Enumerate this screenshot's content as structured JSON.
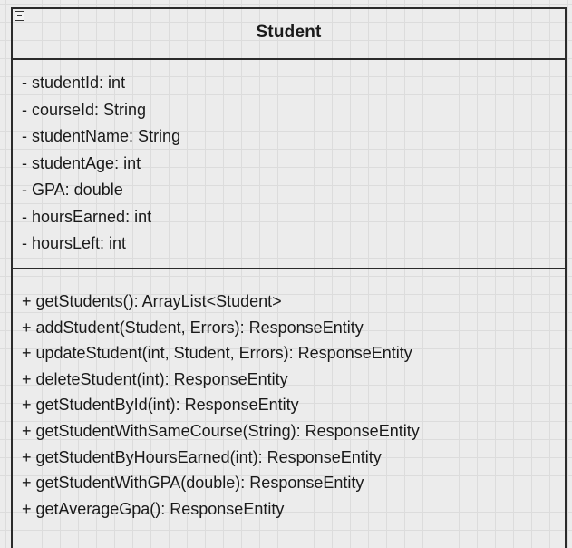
{
  "class": {
    "name": "Student",
    "attributes": [
      "- studentId: int",
      "- courseId: String",
      "- studentName: String",
      "- studentAge: int",
      "- GPA: double",
      "- hoursEarned: int",
      "- hoursLeft: int"
    ],
    "methods": [
      "+ getStudents(): ArrayList<Student>",
      "+ addStudent(Student, Errors): ResponseEntity",
      "+ updateStudent(int, Student, Errors): ResponseEntity",
      "+ deleteStudent(int): ResponseEntity",
      "+ getStudentById(int): ResponseEntity",
      "+ getStudentWithSameCourse(String): ResponseEntity",
      "+ getStudentByHoursEarned(int): ResponseEntity",
      "+ getStudentWithGPA(double): ResponseEntity",
      "+ getAverageGpa(): ResponseEntity"
    ]
  },
  "icons": {
    "collapse": "collapse-minus-icon"
  }
}
